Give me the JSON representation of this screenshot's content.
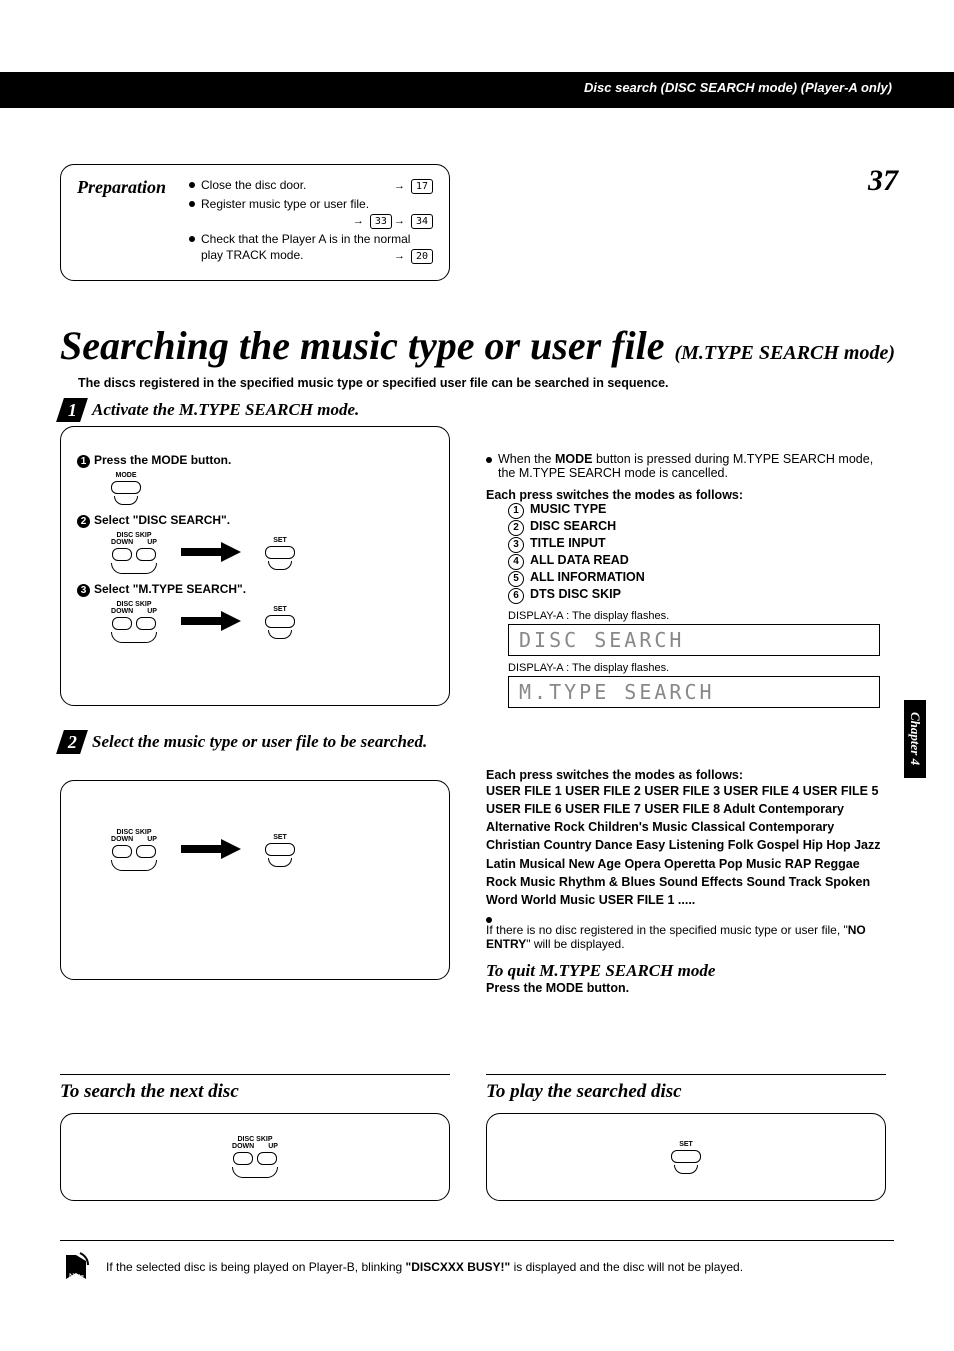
{
  "page_number": "37",
  "header": "Disc search (DISC SEARCH mode) (Player-A only)",
  "chapter_tab": "Chapter 4",
  "preparation": {
    "title": "Preparation",
    "items": [
      {
        "text": "Close the disc door.",
        "refs": [
          "17"
        ]
      },
      {
        "text": "Register music type or user file.",
        "refs": [
          "33",
          "34"
        ]
      },
      {
        "text": "Check that the Player A is in the normal play TRACK mode.",
        "refs": [
          "20"
        ]
      }
    ]
  },
  "title_main": "Searching the music type or user file",
  "title_sub": "(M.TYPE SEARCH mode)",
  "lead": "The discs registered in the specified music type or specified user file can be searched in sequence.",
  "step1": {
    "num": "1",
    "head": "Activate the M.TYPE SEARCH mode.",
    "sub1": "Press the MODE button.",
    "sub2": "Select \"DISC SEARCH\".",
    "sub3": "Select \"M.TYPE SEARCH\".",
    "btn_mode": "MODE",
    "btn_skip": "DISC SKIP",
    "btn_down": "DOWN",
    "btn_up": "UP",
    "btn_set": "SET"
  },
  "step2": {
    "num": "2",
    "head": "Select the music type or user file to be searched."
  },
  "mode_info": {
    "note_pre": "When the ",
    "note_mode": "MODE",
    "note_post": " button is pressed during M.TYPE SEARCH mode, the M.TYPE SEARCH mode is cancelled.",
    "switches": "Each press switches the modes as follows:",
    "items": [
      "MUSIC TYPE",
      "DISC SEARCH",
      "TITLE INPUT",
      "ALL DATA READ",
      "ALL INFORMATION",
      "DTS DISC SKIP"
    ],
    "disp_label": "DISPLAY-A : The display flashes.",
    "lcd1": "DISC SEARCH",
    "lcd2": "M.TYPE SEARCH"
  },
  "genres": {
    "switches": "Each press switches the modes as follows:",
    "list": "USER FILE 1   USER FILE 2   USER FILE 3   USER FILE 4   USER FILE 5   USER FILE 6   USER FILE 7   USER FILE 8   Adult Contemporary   Alternative Rock   Children's Music   Classical   Contemporary Christian   Country   Dance   Easy Listening   Folk   Gospel   Hip Hop   Jazz   Latin   Musical   New Age   Opera   Operetta   Pop Music   RAP   Reggae   Rock Music   Rhythm & Blues   Sound Effects   Sound Track   Spoken Word   World Music   USER FILE 1   .....",
    "no_entry_pre": "If there is no disc registered in the specified music type or user file, \"",
    "no_entry_bold": "NO ENTRY",
    "no_entry_post": "\" will be displayed."
  },
  "quit": {
    "head": "To quit M.TYPE SEARCH mode",
    "body": "Press the MODE button."
  },
  "foot_left": "To search the next disc",
  "foot_right": "To play the searched disc",
  "note": {
    "label": "Note",
    "pre": "If the selected disc is being played on Player-B, blinking ",
    "bold": "\"DISCXXX BUSY!\"",
    "post": " is displayed and the disc will not be played."
  }
}
